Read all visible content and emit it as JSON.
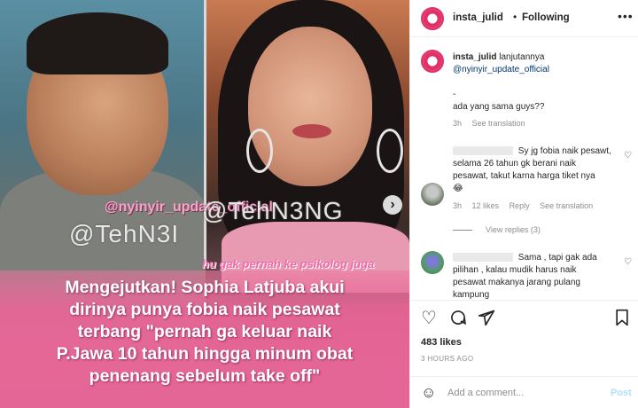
{
  "post": {
    "media": {
      "watermarks": [
        "@nyinyir_update_official",
        "@TehN3I",
        "@TehN3NG"
      ],
      "subtitle": "hu gak pernah ke psikolog juga",
      "caption_lines": [
        "Mengejutkan! Sophia Latjuba akui",
        "dirinya punya fobia naik pesawat",
        "terbang \"pernah ga keluar naik",
        "P.Jawa 10 tahun hingga minum obat",
        "penenang sebelum take off\""
      ],
      "next_icon": "chevron-right-icon"
    },
    "header": {
      "username": "insta_julid",
      "dot": "•",
      "follow_status": "Following",
      "more_icon": "more-horizontal-icon"
    },
    "caption": {
      "username": "insta_julid",
      "text": "lanjutannya",
      "mention": "@nyinyir_update_official",
      "line_dash": "-",
      "line2": "ada yang sama guys??",
      "time": "3h",
      "see_translation": "See translation"
    },
    "comments": [
      {
        "text_lines": [
          "Sy jg fobia naik pesawt,",
          "selama 26 tahun gk berani naik",
          "pesawat, takut karna harga tiket nya",
          "😂"
        ],
        "time": "3h",
        "likes": "12 likes",
        "reply": "Reply",
        "see_translation": "See translation",
        "view_replies": "View replies (3)"
      },
      {
        "text_lines": [
          "Sama , tapi gak ada",
          "pilihan , kalau mudik harus naik",
          "pesawat makanya jarang pulang",
          "kampung"
        ]
      }
    ],
    "likes_count": "483 likes",
    "timestamp": "3 HOURS AGO",
    "add_comment": {
      "placeholder": "Add a comment...",
      "post_label": "Post"
    },
    "colors": {
      "caption_bg": "#e46696",
      "link": "#00376b",
      "post_button": "#b2dffc"
    }
  }
}
